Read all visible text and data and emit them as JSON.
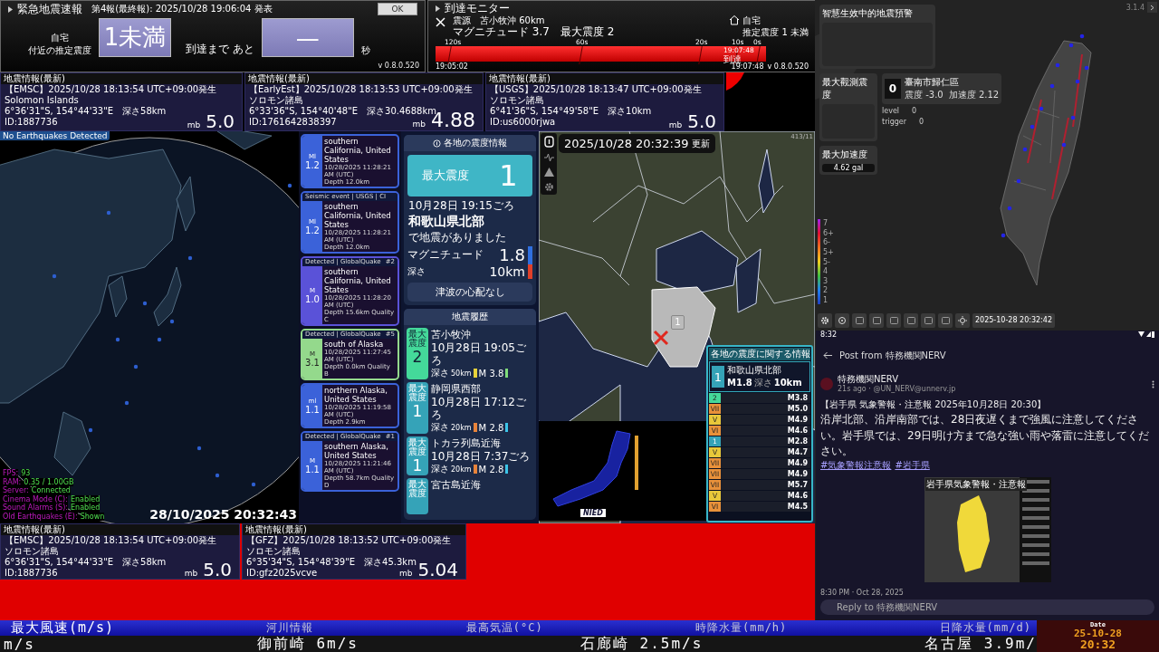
{
  "eew": {
    "title": "緊急地震速報",
    "report": "第4報(最終報): 2025/10/28 19:06:04 発表",
    "ok": "OK",
    "home_label": "自宅",
    "estimate_label": "付近の推定震度",
    "intensity": "1未満",
    "until_label": "到達まで あと",
    "seconds": "—",
    "seconds_unit": "秒",
    "version": "v 0.8.0.520"
  },
  "monitor": {
    "title": "到達モニター",
    "epicenter": "震源　苫小牧沖 60km",
    "magnitude": "マグニチュード 3.7　最大震度 2",
    "home": "自宅",
    "home_estimate": "推定震度 1 未満",
    "ticks": [
      "120s",
      "60s",
      "20s",
      "10s",
      "0s"
    ],
    "start_time": "19:05:02",
    "arrival_time": "19:07:48",
    "arrival_label": "到達",
    "now": "19:07:48",
    "version": "v 0.8.0.520"
  },
  "top_cards": [
    {
      "header": "地震情報(最新)",
      "source": "【EMSC】2025/10/28  18:13:54  UTC+09:00発生",
      "place": "Solomon Islands",
      "coords": "6°36'31\"S,  154°44'33\"E　深さ58km",
      "id": "ID:1887736",
      "scale": "mb",
      "magnitude": "5.0"
    },
    {
      "header": "地震情報(最新)",
      "source": "【EarlyEst】2025/10/28  18:13:53  UTC+09:00発生",
      "place": "ソロモン諸島",
      "coords": "6°33'36\"S,  154°40'48\"E　深さ30.4688km",
      "id": "ID:1761642838397",
      "scale": "mb",
      "magnitude": "4.88"
    },
    {
      "header": "地震情報(最新)",
      "source": "【USGS】2025/10/28  18:13:47  UTC+09:00発生",
      "place": "ソロモン諸島",
      "coords": "6°41'36\"S,  154°49'58\"E　深さ10km",
      "id": "ID:us6000rjwa",
      "scale": "mb",
      "magnitude": "5.0"
    }
  ],
  "globe": {
    "status": "No Earthquakes Detected",
    "stats": [
      {
        "label": "FPS:",
        "value": "93"
      },
      {
        "label": "RAM:",
        "value": "0.35 / 1.00GB"
      },
      {
        "label": "Server:",
        "value": "Connected"
      },
      {
        "label": "Cinema Mode (C):",
        "value": "Enabled"
      },
      {
        "label": "Sound Alarms (S):",
        "value": "Enabled"
      },
      {
        "label": "Old Earthquakes (E):",
        "value": "Shown"
      }
    ],
    "timestamp": "28/10/2025 20:32:43"
  },
  "quake_list": {
    "items": [
      {
        "mag_type": "Ml",
        "magnitude": "1.2",
        "place": "southern California, United States",
        "time": "10/28/2025 11:28:21 AM (UTC)",
        "depth": "Depth 12.0km",
        "color": "#3b62d9"
      },
      {
        "header": "Seismic event | USGS | CI",
        "mag_type": "Ml",
        "magnitude": "1.2",
        "place": "southern California, United States",
        "time": "10/28/2025 11:28:21 AM (UTC)",
        "depth": "Depth 12.0km",
        "color": "#3b62d9"
      },
      {
        "header": "Detected | GlobalQuake",
        "number": "#2",
        "mag_type": "M",
        "magnitude": "1.0",
        "place": "southern California, United States",
        "time": "10/28/2025 11:28:20 AM (UTC)",
        "depth": "Depth 15.6km",
        "quality": "Quality C",
        "color": "#5a52d8"
      },
      {
        "header": "Detected | GlobalQuake",
        "number": "#5",
        "mag_type": "M",
        "magnitude": "3.1",
        "place": "south of Alaska",
        "time": "10/28/2025 11:27:45 AM (UTC)",
        "depth": "Depth 0.0km",
        "quality": "Quality B",
        "color": "#94d98c"
      },
      {
        "mag_type": "ml",
        "magnitude": "1.1",
        "place": "northern Alaska, United States",
        "time": "10/28/2025 11:19:58 AM (UTC)",
        "depth": "Depth 2.9km",
        "color": "#3b62d9"
      },
      {
        "header": "Detected | GlobalQuake",
        "number": "#1",
        "mag_type": "M",
        "magnitude": "1.1",
        "place": "southern Alaska, United States",
        "time": "10/28/2025 11:21:46 AM (UTC)",
        "depth": "Depth 58.7km",
        "quality": "Quality D",
        "color": "#3b62d9"
      }
    ]
  },
  "info": {
    "title": "各地の震度情報",
    "max_label": "最大震度",
    "max_intensity": "1",
    "time": "10月28日 19:15ごろ",
    "place": "和歌山県北部",
    "occurred": "で地震がありました",
    "magnitude_label": "マグニチュード",
    "magnitude": {
      "value": "1.8",
      "color": "#2f6fe0"
    },
    "depth_label": "深さ",
    "depth": {
      "value": "10km",
      "color": "#e0402a"
    },
    "tsunami": "津波の心配なし"
  },
  "history": {
    "title": "地震履歴",
    "items": [
      {
        "label": "最大震度",
        "intensity": "2",
        "color": "#44d99a",
        "place": "苫小牧沖",
        "time": "10月28日 19:05ごろ",
        "depth_label": "深さ",
        "depth": {
          "value": "50km",
          "color": "#e8d23a"
        },
        "magnitude": {
          "value": "M 3.8",
          "color": "#7fdc7a"
        }
      },
      {
        "label": "最大震度",
        "intensity": "1",
        "color": "#35a3b8",
        "place": "静岡県西部",
        "time": "10月28日 17:12ごろ",
        "depth_label": "深さ",
        "depth": {
          "value": "20km",
          "color": "#e8833a"
        },
        "magnitude": {
          "value": "M 2.8",
          "color": "#3cc4e8"
        }
      },
      {
        "label": "最大震度",
        "intensity": "1",
        "color": "#35a3b8",
        "place": "トカラ列島近海",
        "time": "10月28日 7:37ごろ",
        "depth_label": "深さ",
        "depth": {
          "value": "20km",
          "color": "#e8833a"
        },
        "magnitude": {
          "value": "M 2.8",
          "color": "#3cc4e8"
        }
      },
      {
        "label": "最大震度",
        "color": "#35a3b8",
        "place": "宮古島近海"
      }
    ]
  },
  "map": {
    "timestamp": "2025/10/28  20:32:39",
    "updated": "更新",
    "version": "413/11",
    "marker": "1",
    "inset_logo": "NIED"
  },
  "intensity_panel": {
    "title": "各地の震度に関する情報",
    "latest": {
      "intensity": "1",
      "place": "和歌山県北部",
      "magnitude": "M1.8",
      "depth_label": "深さ",
      "depth": "10km"
    },
    "items": [
      {
        "intensity": "2",
        "color": "#44d99a",
        "magnitude": "M3.8"
      },
      {
        "intensity": "VII",
        "color": "#e8913a",
        "magnitude": "M5.0"
      },
      {
        "intensity": "V",
        "color": "#e8c83a",
        "magnitude": "M4.9"
      },
      {
        "intensity": "VI",
        "color": "#e8913a",
        "magnitude": "M4.6"
      },
      {
        "intensity": "1",
        "color": "#35a3b8",
        "magnitude": "M2.8"
      },
      {
        "intensity": "V",
        "color": "#e8c83a",
        "magnitude": "M4.7"
      },
      {
        "intensity": "VII",
        "color": "#e8913a",
        "magnitude": "M4.9"
      },
      {
        "intensity": "VII",
        "color": "#e8913a",
        "magnitude": "M4.9"
      },
      {
        "intensity": "VII",
        "color": "#e8913a",
        "magnitude": "M5.7"
      },
      {
        "intensity": "V",
        "color": "#e8c83a",
        "magnitude": "M4.6"
      },
      {
        "intensity": "VI",
        "color": "#e8913a",
        "magnitude": "M4.5"
      }
    ]
  },
  "taiwan": {
    "title": "智慧生效中的地震預警",
    "max_observed_label": "最大觀測震度",
    "station_intensity": "0",
    "station": "臺南市歸仁區",
    "station_intensity_reading": "震度 -3.0",
    "station_accel": "加速度 2.12",
    "level_label": "level",
    "level": "0",
    "trigger_label": "trigger",
    "trigger": "0",
    "max_accel_label": "最大加速度",
    "max_accel": "4.62 gal",
    "version": "3.1.4",
    "scale": [
      "7",
      "6+",
      "6-",
      "5+",
      "5-",
      "4",
      "3",
      "2",
      "1"
    ],
    "timestamp": "2025-10-28 20:32:42"
  },
  "post": {
    "clock": "8:32",
    "header": "Post from 特務機関NERV",
    "author": "特務機関NERV",
    "meta": "21s ago · @UN_NERV@unnerv.jp",
    "title": "【岩手県 気象警報・注意報 2025年10月28日 20:30】",
    "body": "沿岸北部、沿岸南部では、28日夜遅くまで強風に注意してください。岩手県では、29日明け方まで急な強い雨や落雷に注意してください。",
    "hashtags": [
      "#気象警報注意報",
      "#岩手県"
    ],
    "image_title": "岩手県気象警報・注意報",
    "posted": "8:30 PM · Oct 28, 2025",
    "reply_placeholder": "Reply to 特務機関NERV"
  },
  "bottom_cards": [
    {
      "header": "地震情報(最新)",
      "source": "【EMSC】2025/10/28  18:13:54  UTC+09:00発生",
      "place": "ソロモン諸島",
      "coords": "6°36'31\"S,  154°44'33\"E　深さ58km",
      "id": "ID:1887736",
      "scale": "mb",
      "magnitude": "5.0"
    },
    {
      "header": "地震情報(最新)",
      "source": "【GFZ】2025/10/28  18:13:52  UTC+09:00発生",
      "place": "ソロモン諸島",
      "coords": "6°35'34\"S,  154°48'39\"E　深さ45.3km",
      "id": "ID:gfz2025vcve",
      "scale": "mb",
      "magnitude": "5.04"
    }
  ],
  "ticker": {
    "headings": [
      "最大風速(m/s)",
      "河川情報",
      "最高気温(°C)",
      "時降水量(mm/h)",
      "日降水量(mm/d)"
    ],
    "values": [
      "m/s",
      "御前崎 6m/s",
      "石廊崎 2.5m/s",
      "名古屋 3.9m/"
    ],
    "date_label": "Date",
    "date": "25-10-28",
    "time": "20:32"
  }
}
